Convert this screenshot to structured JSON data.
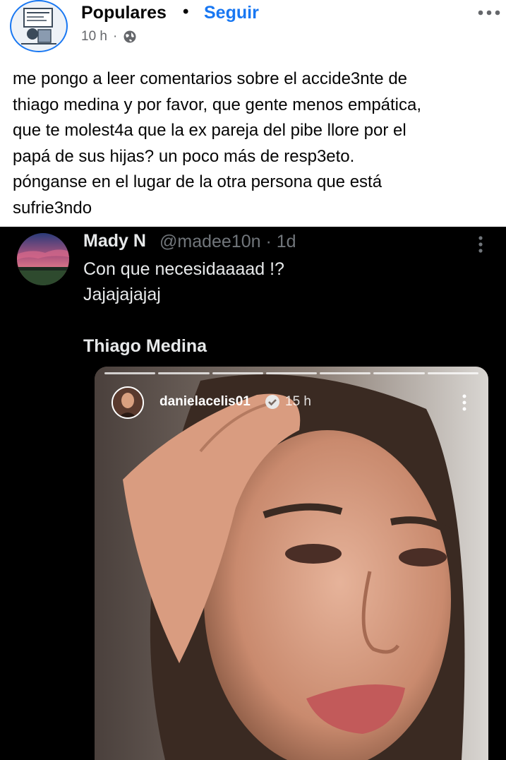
{
  "post": {
    "page_name": "Populares",
    "separator": "•",
    "follow_label": "Seguir",
    "time": "10 h",
    "time_dot": "·",
    "audience_icon": "globe-icon",
    "more_icon": "more-horizontal-icon",
    "caption_lines": [
      "me pongo a leer comentarios sobre el accide3nte de",
      "thiago medina y por favor, que gente menos empática,",
      "que te molest4a que la ex pareja del pibe llore por el",
      "papá de sus hijas? un poco más de resp3eto.",
      "pónganse en el lugar de la otra persona que está",
      "sufrie3ndo"
    ]
  },
  "tweet": {
    "name": "Mady N",
    "handle_time": "@madee10n · 1d",
    "text_line1": "Con que necesidaaaad !?",
    "text_line2": "Jajajajajaj",
    "text_line3": "Thiago Medina",
    "more_icon": "more-vertical-icon"
  },
  "story": {
    "username": "danielacelis01",
    "time": "15 h",
    "verified_icon": "verified-badge-icon",
    "more_icon": "more-vertical-icon",
    "progress_bars": 7
  },
  "colors": {
    "accent": "#1877f2",
    "text": "#050505",
    "muted": "#65676b",
    "embed_bg": "#000000",
    "tweet_text": "#e7e9ea",
    "tweet_muted": "#71767b"
  }
}
